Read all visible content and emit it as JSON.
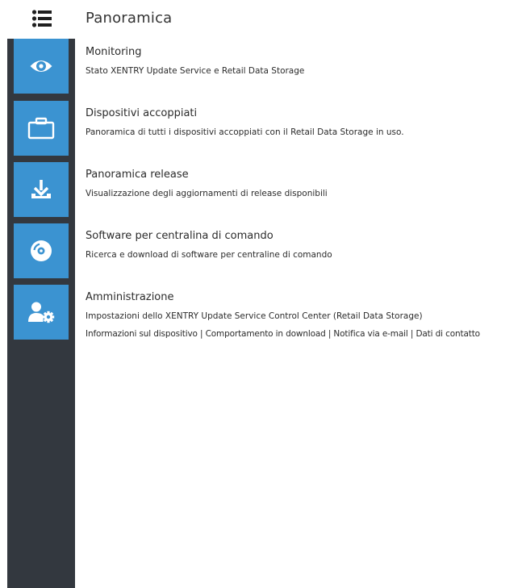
{
  "header": {
    "title": "Panoramica",
    "menu_icon": "list-menu-icon"
  },
  "sidebar": {
    "items": [
      {
        "icon": "eye-icon",
        "target": "Monitoring"
      },
      {
        "icon": "briefcase-icon",
        "target": "Dispositivi accoppiati"
      },
      {
        "icon": "download-icon",
        "target": "Panoramica release"
      },
      {
        "icon": "disc-icon",
        "target": "Software per centralina di comando"
      },
      {
        "icon": "user-settings-icon",
        "target": "Amministrazione"
      }
    ]
  },
  "sections": [
    {
      "title": "Monitoring",
      "description": "Stato XENTRY Update Service e Retail Data Storage"
    },
    {
      "title": "Dispositivi accoppiati",
      "description": "Panoramica di tutti i dispositivi accoppiati con il Retail Data Storage in uso."
    },
    {
      "title": "Panoramica release",
      "description": "Visualizzazione degli aggiornamenti di release disponibili"
    },
    {
      "title": "Software per centralina di comando",
      "description": "Ricerca e download di software per centraline di comando"
    },
    {
      "title": "Amministrazione",
      "description": "Impostazioni dello XENTRY Update Service Control Center (Retail Data Storage)",
      "links": "Informazioni sul dispositivo | Comportamento in download | Notifica via e-mail | Dati di contatto"
    }
  ],
  "colors": {
    "sidebar_bg": "#33383f",
    "tile_bg": "#3b93d1",
    "icon": "#ffffff"
  }
}
